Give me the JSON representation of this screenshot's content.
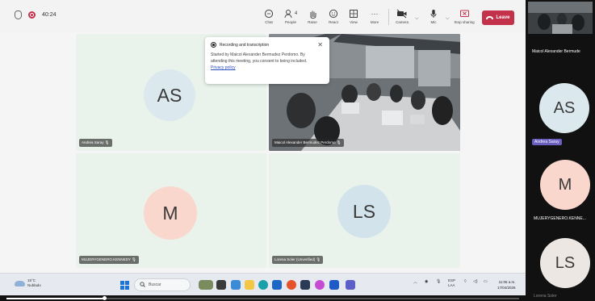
{
  "meeting": {
    "timer": "40:24"
  },
  "toolbar": {
    "chat": "Chat",
    "people": "People",
    "people_count": "4",
    "raise": "Raise",
    "react": "React",
    "view": "View",
    "more": "More",
    "camera": "Camera",
    "mic": "Mic",
    "stop_sharing": "Stop sharing",
    "leave": "Leave",
    "leave_color": "#c4314b"
  },
  "popup": {
    "title": "Recording and transcription",
    "body": "Started by Maicol Alexander Bermudez Perdomo. By attending this meeting, you consent to being included.",
    "link": "Privacy policy"
  },
  "tiles": [
    {
      "initials": "AS",
      "name": "Andrea Saray",
      "avatar_color": "#dbe9ee"
    },
    {
      "initials": "",
      "name": "Maicol Alexander Bermudez Perdomo"
    },
    {
      "initials": "M",
      "name": "MUJERYGENERO.KENNEDY",
      "avatar_color": "#f9d7cd"
    },
    {
      "initials": "LS",
      "name": "Lorena Soler (Unverified)",
      "avatar_color": "#d3e3ec"
    }
  ],
  "sidebar": {
    "title": "Maicol Alexander Bermude",
    "people": [
      {
        "initials": "AS",
        "name": "Andrea Saray",
        "avatar_color": "#dbe9ee"
      },
      {
        "initials": "M",
        "name": "MUJERYGENERO.KENNE...",
        "avatar_color": "#f9d7cd"
      },
      {
        "initials": "LS",
        "name": "Lorena Soler",
        "avatar_color": "#ece7e3"
      }
    ]
  },
  "taskbar": {
    "temp": "15°C",
    "weather": "Nublado",
    "search": "Buscar",
    "lang": "ESP",
    "lang_sub": "LAA",
    "time": "11:06 a.m.",
    "date": "17/04/2026"
  },
  "playback": {
    "progress": 0.19
  }
}
